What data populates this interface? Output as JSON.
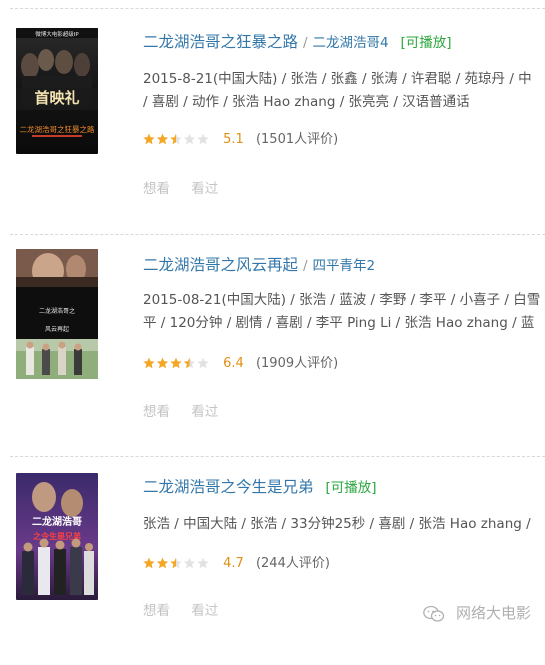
{
  "movies": [
    {
      "title": "二龙湖浩哥之狂暴之路",
      "sep": "/",
      "alt_title": "二龙湖浩哥4",
      "playable": "[可播放]",
      "meta_line1": "2015-8-21(中国大陆) / 张浩 / 张鑫 / 张涛 / 许君聪 / 苑琼丹 / 中",
      "meta_line2": "/ 喜剧 / 动作 / 张浩 Hao zhang / 张亮亮 / 汉语普通话",
      "poster_top_text": "微博大电影超级IP",
      "poster_center_text": "首映礼",
      "poster_sub_text": "二龙湖浩哥之狂暴之路",
      "rating_stars": 2.5,
      "score": "5.1",
      "count": "(1501人评价)",
      "want": "想看",
      "seen": "看过"
    },
    {
      "title": "二龙湖浩哥之风云再起",
      "sep": "/",
      "alt_title": "四平青年2",
      "meta_line1": "2015-08-21(中国大陆) / 张浩 / 蓝波 / 李野 / 李平 / 小喜子 / 白雪",
      "meta_line2": "平 / 120分钟 / 剧情 / 喜剧 / 李平 Ping Li / 张浩 Hao zhang / 蓝",
      "poster_title_text": "二龙湖浩哥之",
      "poster_title_text2": "风云再起",
      "rating_stars": 3.5,
      "score": "6.4",
      "count": "(1909人评价)",
      "want": "想看",
      "seen": "看过"
    },
    {
      "title": "二龙湖浩哥之今生是兄弟",
      "playable": "[可播放]",
      "meta_line1": "张浩 / 中国大陆 / 张浩 / 33分钟25秒 / 喜剧 / 张浩 Hao zhang /",
      "poster_title_text": "二龙湖浩哥",
      "poster_sub_text": "之今生是兄弟",
      "rating_stars": 2.5,
      "score": "4.7",
      "count": "(244人评价)",
      "want": "想看",
      "seen": "看过"
    }
  ],
  "watermark": "网络大电影",
  "icons": {
    "star_full": "star-full-icon",
    "star_half": "star-half-icon",
    "star_empty": "star-empty-icon",
    "watermark": "wechat-icon"
  },
  "colors": {
    "link": "#3377aa",
    "playable": "#2aa63d",
    "score": "#e09015",
    "star": "#f5a623",
    "muted": "#c4c4c4"
  }
}
